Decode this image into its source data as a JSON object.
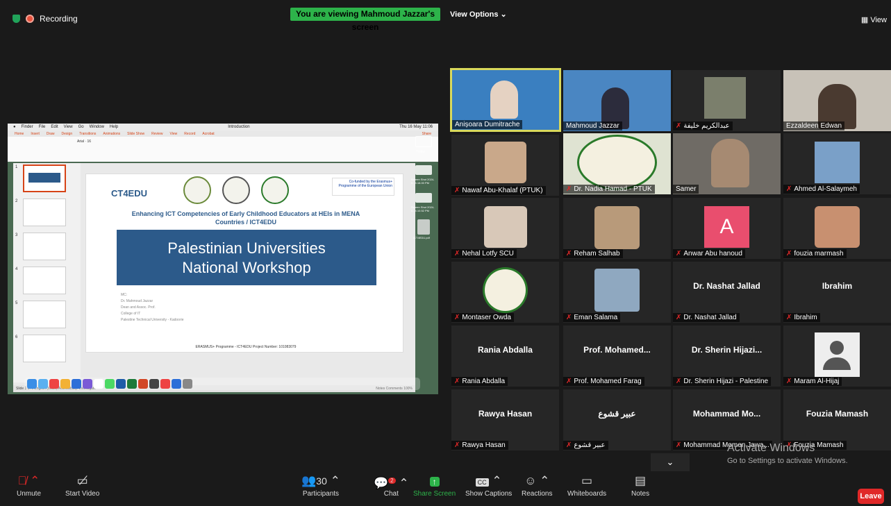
{
  "top": {
    "recording": "Recording",
    "viewing": "You are viewing Mahmoud Jazzar's screen",
    "view_options": "View Options",
    "view_label": "View"
  },
  "share": {
    "macos": {
      "menu": [
        "Finder",
        "File",
        "Edit",
        "View",
        "Go",
        "Window",
        "Help"
      ],
      "clock": "Thu 16 May 11:06",
      "window_title": "Introduction"
    },
    "ribbon_tabs": [
      "Home",
      "Insert",
      "Draw",
      "Design",
      "Transitions",
      "Animations",
      "Slide Show",
      "Review",
      "View",
      "Record",
      "Acrobat"
    ],
    "font_name": "Arial",
    "font_size": "16",
    "share_btn": "Share",
    "slide": {
      "logo_text": "CT4EDU",
      "eu_text": "Co-funded by the Erasmus+ Programme of the European Union",
      "subtitle": "Enhancing ICT Competencies of Early Childhood Educators at HEIs in MENA Countries / ICT4EDU",
      "title_line1": "Palestinian Universities",
      "title_line2": "National Workshop",
      "info": [
        "MC:",
        "Dr. Mahmoud Jazzar",
        "Dean and Assoc. Prof.",
        "College of IT",
        "Palestine Technical University - Kadoorie"
      ],
      "footer": "ERASMUS+ Programme - ICT4EDU Project Number: 101083079"
    },
    "thumb_numbers": [
      "1",
      "2",
      "3",
      "4",
      "5",
      "6"
    ],
    "status_left": "Slide 1 of 6   English (Israel)   Accessibility: Investigate",
    "status_right": "Notes   Comments   100%",
    "desktop_labels": [
      "Today",
      "Screen Shot 2024-0...5.16.00 PM",
      "Screen Shot 2024-0...4.10.52 PM",
      "ICT4EDU.pdf"
    ]
  },
  "tiles": [
    {
      "name": "Anișoara Dumitrache",
      "muted": false,
      "speaker": true
    },
    {
      "name": "Mahmoud Jazzar",
      "muted": false
    },
    {
      "name": "عبدالكريم خليفة",
      "muted": true
    },
    {
      "name": "Ezzaldeen Edwan",
      "muted": false
    },
    {
      "name": "Nawaf Abu-Khalaf (PTUK)",
      "muted": true
    },
    {
      "name": "Dr. Nadia Hamad - PTUK",
      "muted": true
    },
    {
      "name": "Samer",
      "muted": false
    },
    {
      "name": "Ahmed Al-Salaymeh",
      "muted": true
    },
    {
      "name": "Nehal Lotfy SCU",
      "muted": true
    },
    {
      "name": "Reham Salhab",
      "muted": true
    },
    {
      "name": "Anwar Abu hanoud",
      "muted": true,
      "avatar": "A"
    },
    {
      "name": "fouzia marmash",
      "muted": true
    },
    {
      "name": "Montaser Owda",
      "muted": true
    },
    {
      "name": "Eman Salama",
      "muted": true
    },
    {
      "name": "Dr. Nashat Jallad",
      "muted": true,
      "big": "Dr. Nashat Jallad"
    },
    {
      "name": "Ibrahim",
      "muted": true,
      "big": "Ibrahim"
    },
    {
      "name": "Rania Abdalla",
      "muted": true,
      "big": "Rania Abdalla"
    },
    {
      "name": "Prof. Mohamed Farag",
      "muted": true,
      "big": "Prof.  Mohamed..."
    },
    {
      "name": "Dr. Sherin Hijazi - Palestine",
      "muted": true,
      "big": "Dr.  Sherin  Hijazi..."
    },
    {
      "name": "Maram Al-Hijaj",
      "muted": true
    },
    {
      "name": "Rawya Hasan",
      "muted": true,
      "big": "Rawya Hasan"
    },
    {
      "name": "عبير قشوع",
      "muted": true,
      "big": "عبير قشوع"
    },
    {
      "name": "Mohammad Momen Jawa...",
      "muted": true,
      "big": "Mohammad  Mo..."
    },
    {
      "name": "Fouzia Mamash",
      "muted": true,
      "big": "Fouzia Mamash"
    }
  ],
  "activate": {
    "line1": "Activate Windows",
    "line2": "Go to Settings to activate Windows."
  },
  "toolbar": {
    "unmute": "Unmute",
    "start_video": "Start Video",
    "participants": "Participants",
    "participants_count": "30",
    "chat": "Chat",
    "chat_badge": "2",
    "share_screen": "Share Screen",
    "captions": "Show Captions",
    "captions_icon": "CC",
    "reactions": "Reactions",
    "whiteboards": "Whiteboards",
    "notes": "Notes",
    "leave": "Leave"
  },
  "colors": {
    "accent_green": "#2db34a",
    "leave_red": "#e02828",
    "speaker_border": "#d9d95b",
    "avatar_pink": "#e94e6e"
  }
}
